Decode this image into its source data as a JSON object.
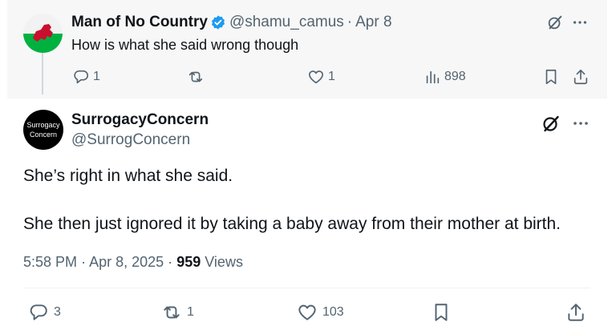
{
  "parent": {
    "name": "Man of No Country",
    "handle": "@shamu_camus",
    "dot": "·",
    "date": "Apr 8",
    "text": "How is what she said wrong though",
    "reply_count": "1",
    "retweet_count": "",
    "like_count": "1",
    "views": "898",
    "avatar_icon": "wales-flag-icon"
  },
  "main": {
    "avatar_line1": "Surrogacy",
    "avatar_line2": "Concern",
    "name": "SurrogacyConcern",
    "handle": "@SurrogConcern",
    "paragraph1": "She’s right in what she said.",
    "paragraph2": "She then just ignored it by taking a baby away from their mother at birth.",
    "time": "5:58 PM",
    "dot": "·",
    "date": "Apr 8, 2025",
    "dot2": "·",
    "views_count": "959",
    "views_label": "Views",
    "reply_count": "3",
    "retweet_count": "1",
    "like_count": "103"
  },
  "colors": {
    "verified": "#1d9bf0",
    "text": "#0f1419",
    "muted": "#536471",
    "wales_red": "#c8102e",
    "wales_green": "#00b140"
  }
}
